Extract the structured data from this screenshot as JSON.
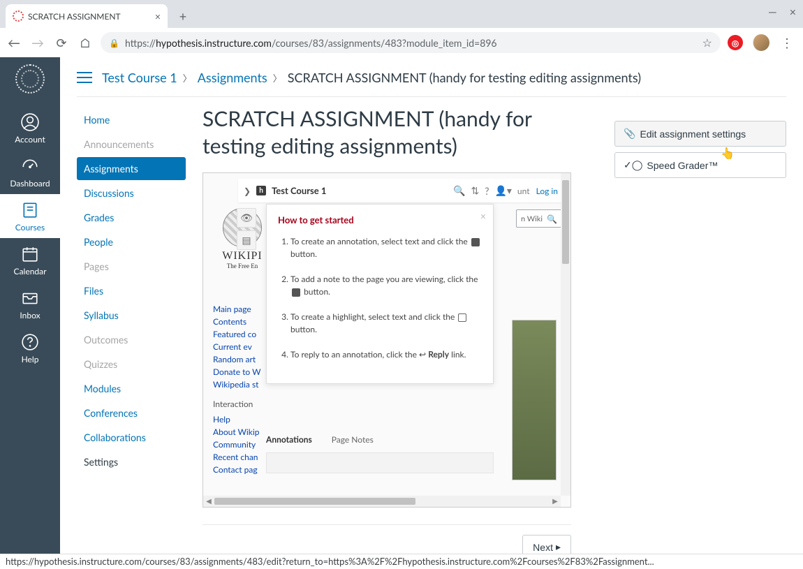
{
  "browser": {
    "tab_title": "SCRATCH ASSIGNMENT",
    "url_host": "hypothesis.instructure.com",
    "url_path": "/courses/83/assignments/483?module_item_id=896",
    "url_scheme": "https://",
    "status_url": "https://hypothesis.instructure.com/courses/83/assignments/483/edit?return_to=https%3A%2F%2Fhypothesis.instructure.com%2Fcourses%2F83%2Fassignment..."
  },
  "global_nav": {
    "account": "Account",
    "dashboard": "Dashboard",
    "courses": "Courses",
    "calendar": "Calendar",
    "inbox": "Inbox",
    "help": "Help"
  },
  "breadcrumb": {
    "course": "Test Course 1",
    "section": "Assignments",
    "current": "SCRATCH ASSIGNMENT (handy for testing editing assignments)"
  },
  "course_nav": [
    {
      "label": "Home",
      "active": false,
      "disabled": false
    },
    {
      "label": "Announcements",
      "active": false,
      "disabled": true
    },
    {
      "label": "Assignments",
      "active": true,
      "disabled": false
    },
    {
      "label": "Discussions",
      "active": false,
      "disabled": false
    },
    {
      "label": "Grades",
      "active": false,
      "disabled": false
    },
    {
      "label": "People",
      "active": false,
      "disabled": false
    },
    {
      "label": "Pages",
      "active": false,
      "disabled": true
    },
    {
      "label": "Files",
      "active": false,
      "disabled": false
    },
    {
      "label": "Syllabus",
      "active": false,
      "disabled": false
    },
    {
      "label": "Outcomes",
      "active": false,
      "disabled": true
    },
    {
      "label": "Quizzes",
      "active": false,
      "disabled": true
    },
    {
      "label": "Modules",
      "active": false,
      "disabled": false
    },
    {
      "label": "Conferences",
      "active": false,
      "disabled": false
    },
    {
      "label": "Collaborations",
      "active": false,
      "disabled": false
    },
    {
      "label": "Settings",
      "active": false,
      "disabled": false,
      "plain": true
    }
  ],
  "page": {
    "title": "SCRATCH ASSIGNMENT (handy for testing editing assignments)",
    "next": "Next"
  },
  "side_actions": {
    "edit": "Edit assignment settings",
    "speedgrader": "Speed Grader™"
  },
  "hypothesis": {
    "course": "Test Course 1",
    "account_short": "unt",
    "login": "Log in",
    "search_placeholder": "n Wiki",
    "help_title": "How to get started",
    "steps": {
      "s1a": "To create an annotation, select text and click the",
      "s1b": "button.",
      "s2a": "To add a note to the page you are viewing, click the",
      "s2b": "button.",
      "s3a": "To create a highlight, select text and click the",
      "s3b": "button.",
      "s4a": "To reply to an annotation, click the ",
      "s4b_reply": "Reply",
      "s4c": " link."
    },
    "tabs": {
      "annotations": "Annotations",
      "pagenotes": "Page Notes"
    }
  },
  "wiki": {
    "name": "WIKIPI",
    "tag": "The Free En",
    "links1": [
      "Main page",
      "Contents",
      "Featured co",
      "Current ev",
      "Random art",
      "Donate to W",
      "Wikipedia st"
    ],
    "heading": "Interaction",
    "links2": [
      "Help",
      "About Wikip",
      "Community",
      "Recent chan",
      "Contact pag"
    ]
  }
}
